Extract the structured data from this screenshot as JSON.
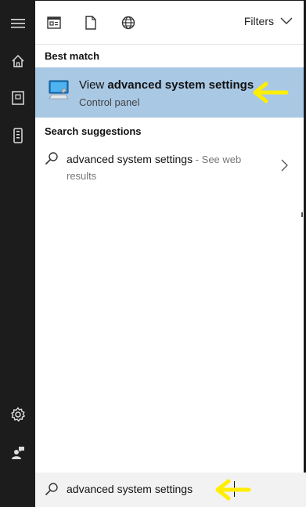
{
  "colors": {
    "rail_bg": "#1c1c1c",
    "panel_bg": "#ffffff",
    "selected_bg": "#a8c8e4",
    "annotation_arrow": "#ffee00",
    "search_bg": "#f2f2f2"
  },
  "sidebar": {
    "icons": [
      "hamburger-menu-icon",
      "home-icon",
      "notebook-icon",
      "device-icon",
      "settings-gear-icon",
      "feedback-person-icon"
    ]
  },
  "toolbar": {
    "icons": [
      "apps-icon",
      "documents-icon",
      "web-globe-icon"
    ],
    "filters_label": "Filters"
  },
  "best_match": {
    "section_label": "Best match",
    "title_prefix": "View ",
    "title_bold": "advanced system settings",
    "subtitle": "Control panel",
    "icon": "monitor-settings-icon"
  },
  "suggestions": {
    "section_label": "Search suggestions",
    "items": [
      {
        "query": "advanced system settings",
        "separator": " - ",
        "hint": "See web results"
      }
    ]
  },
  "search": {
    "value": "advanced system settings",
    "icon": "search-icon"
  }
}
